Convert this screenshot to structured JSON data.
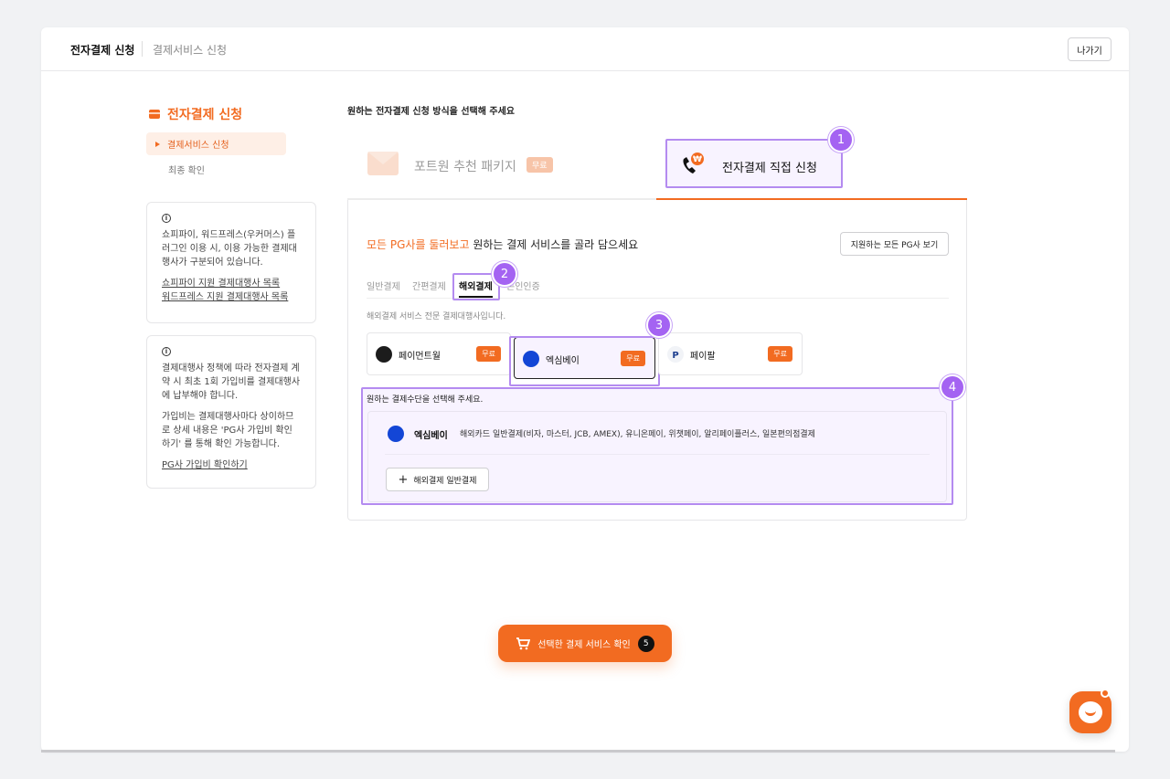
{
  "topbar": {
    "breadcrumb_main": "전자결제 신청",
    "breadcrumb_sub": "결제서비스 신청",
    "exit_label": "나가기"
  },
  "sidebar": {
    "title": "전자결제 신청",
    "items": [
      {
        "label": "결제서비스 신청",
        "active": true
      },
      {
        "label": "최종 확인",
        "active": false
      }
    ],
    "info1": {
      "text": "쇼피파이, 워드프레스(우커머스) 플러그인 이용 시, 이용 가능한 결제대행사가 구분되어 있습니다.",
      "link1": "쇼피파이 지원 결제대행사 목록",
      "link2": "워드프레스 지원 결제대행사 목록"
    },
    "info2": {
      "text1": "결제대행사 정책에 따라 전자결제 계약 시 최초 1회 가입비를 결제대행사에 납부해야 합니다.",
      "text2": "가입비는 결제대행사마다 상이하므로 상세 내용은 'PG사 가입비 확인하기' 를 통해 확인 가능합니다.",
      "link": "PG사 가입비 확인하기"
    }
  },
  "main": {
    "heading": "원하는 전자결제 신청 방식을 선택해 주세요",
    "tabs": [
      {
        "label": "포트원 추천 패키지",
        "badge": "무료",
        "active": false
      },
      {
        "label": "전자결제 직접 신청",
        "active": true
      }
    ],
    "panel": {
      "headline_accent": "모든 PG사를 둘러보고",
      "headline_rest": " 원하는 결제 서비스를 골라 담으세요",
      "all_pg_button": "지원하는 모든 PG사 보기",
      "subtabs": [
        "일반결제",
        "간편결제",
        "해외결제",
        "본인인증"
      ],
      "active_subtab": "해외결제",
      "description": "해외결제 서비스 전문 결제대행사입니다.",
      "pg_cards": [
        {
          "name": "페이먼트월",
          "badge": "무료",
          "logo_color": "#1c1c1c"
        },
        {
          "name": "엑심베이",
          "badge": "무료",
          "logo_color": "#1346d6",
          "selected": true
        },
        {
          "name": "페이팔",
          "badge": "무료",
          "logo_color": "#f1f3f7"
        }
      ],
      "method": {
        "title": "원하는 결제수단을 선택해 주세요.",
        "pg_name": "엑심베이",
        "pg_desc": "해외카드 일반결제(비자, 마스터, JCB, AMEX), 유니온페이, 위챗페이, 알리페이플러스, 일본편의점결제",
        "add_button": "해외결제 일반결제"
      }
    },
    "cart_button": {
      "label": "선택한 결제 서비스 확인",
      "count": "5"
    }
  },
  "step_markers": [
    "1",
    "2",
    "3",
    "4"
  ],
  "colors": {
    "accent": "#f26b21",
    "highlight": "#b48bf0",
    "step": "#a463f2"
  }
}
